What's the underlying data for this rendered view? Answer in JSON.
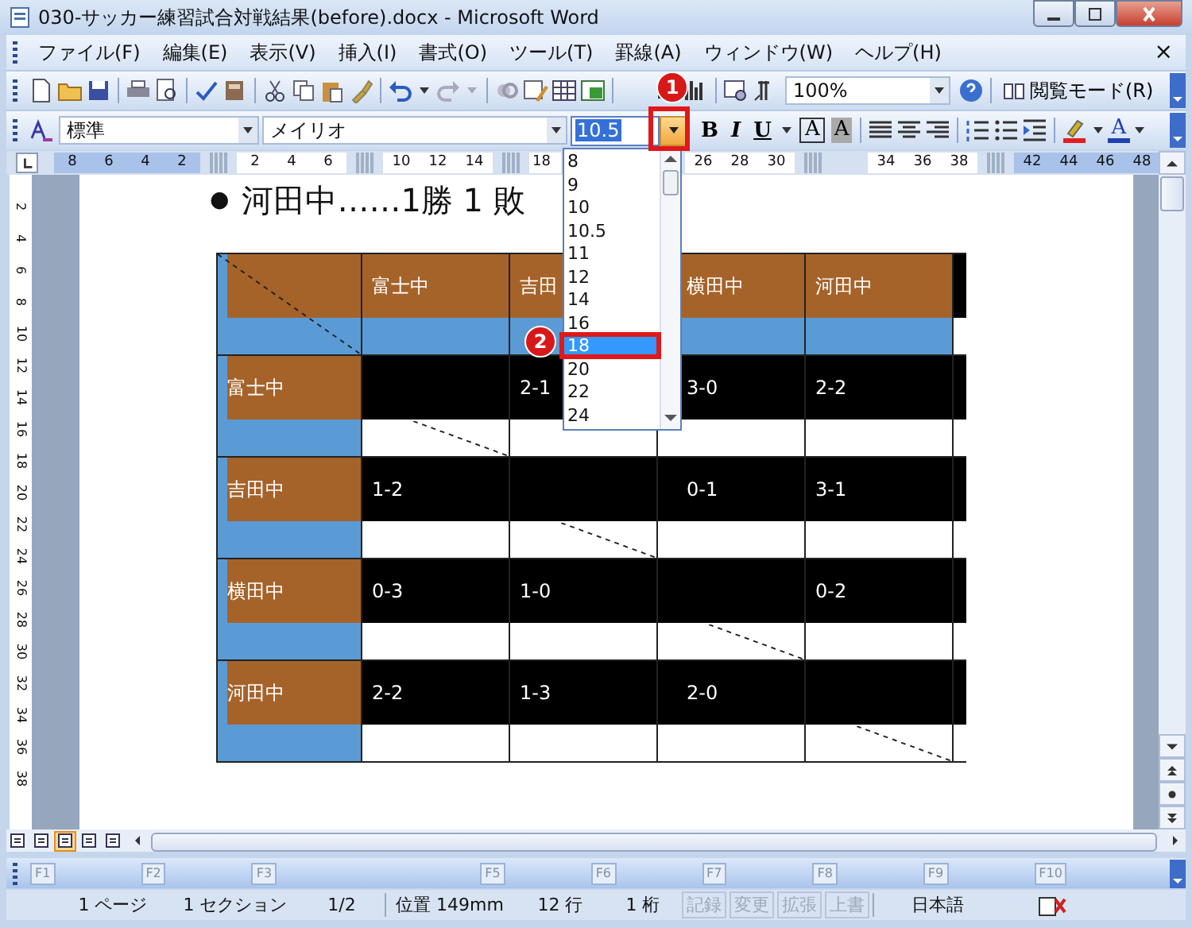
{
  "window": {
    "title": "030-サッカー練習試合対戦結果(before).docx - Microsoft Word"
  },
  "menu": {
    "items": [
      "ファイル(F)",
      "編集(E)",
      "表示(V)",
      "挿入(I)",
      "書式(O)",
      "ツール(T)",
      "罫線(A)",
      "ウィンドウ(W)",
      "ヘルプ(H)"
    ],
    "close": "×"
  },
  "standard_toolbar": {
    "zoom": "100%",
    "reading_mode": "閲覧モード(R)"
  },
  "format_toolbar": {
    "style": "標準",
    "font": "メイリオ",
    "size": "10.5",
    "bold": "B",
    "italic": "I",
    "underline": "U",
    "char_border": "A",
    "char_shading": "A",
    "font_color": "A"
  },
  "ruler": {
    "groups": [
      {
        "kind": "margin",
        "labels": [
          "8",
          "6",
          "4",
          "2"
        ]
      },
      {
        "kind": "text",
        "labels": [
          "2",
          "4",
          "6"
        ]
      },
      {
        "kind": "text",
        "labels": [
          "10",
          "12",
          "14"
        ]
      },
      {
        "kind": "text",
        "labels": [
          "18"
        ]
      },
      {
        "kind": "text",
        "labels": [
          "26",
          "28",
          "30"
        ]
      },
      {
        "kind": "text",
        "labels": [
          "34",
          "36",
          "38"
        ]
      },
      {
        "kind": "margin",
        "labels": [
          "42",
          "44",
          "46",
          "48"
        ]
      }
    ]
  },
  "vertical_ruler": [
    "2",
    "4",
    "6",
    "8",
    "10",
    "12",
    "14",
    "16",
    "18",
    "20",
    "22",
    "24",
    "26",
    "28",
    "30",
    "32",
    "34",
    "36",
    "38"
  ],
  "document": {
    "bullet": "●",
    "heading": "河田中……1勝 1 敗",
    "table": {
      "header": [
        {
          "diagonal": true
        },
        {
          "text": "富士中",
          "diagonal": false
        },
        {
          "text": "吉田",
          "diagonal": false
        },
        {
          "text": "横田中",
          "diagonal": false
        },
        {
          "text": "河田中",
          "diagonal": false
        }
      ],
      "rows": [
        {
          "team": "富士中",
          "cells": [
            {
              "diagonal": true
            },
            {
              "text": "2-1",
              "diagonal": false
            },
            {
              "text": "3-0",
              "diagonal": false
            },
            {
              "text": "2-2",
              "diagonal": false
            }
          ]
        },
        {
          "team": "吉田中",
          "cells": [
            {
              "text": "1-2",
              "diagonal": false
            },
            {
              "diagonal": true
            },
            {
              "text": "0-1",
              "diagonal": false
            },
            {
              "text": "3-1",
              "diagonal": false
            }
          ]
        },
        {
          "team": "横田中",
          "cells": [
            {
              "text": "0-3",
              "diagonal": false
            },
            {
              "text": "1-0",
              "diagonal": false
            },
            {
              "diagonal": true
            },
            {
              "text": "0-2",
              "diagonal": false
            }
          ]
        },
        {
          "team": "河田中",
          "cells": [
            {
              "text": "2-2",
              "diagonal": false
            },
            {
              "text": "1-3",
              "diagonal": false
            },
            {
              "text": "2-0",
              "diagonal": false
            },
            {
              "diagonal": true
            }
          ]
        }
      ]
    }
  },
  "size_list": [
    {
      "label": "8",
      "selected": false
    },
    {
      "label": "9",
      "selected": false
    },
    {
      "label": "10",
      "selected": false
    },
    {
      "label": "10.5",
      "selected": false
    },
    {
      "label": "11",
      "selected": false
    },
    {
      "label": "12",
      "selected": false
    },
    {
      "label": "14",
      "selected": false
    },
    {
      "label": "16",
      "selected": false
    },
    {
      "label": "18",
      "selected": true
    },
    {
      "label": "20",
      "selected": false
    },
    {
      "label": "22",
      "selected": false
    },
    {
      "label": "24",
      "selected": false
    }
  ],
  "callouts": [
    "1",
    "2"
  ],
  "view_buttons": [
    {
      "selected": false
    },
    {
      "selected": false
    },
    {
      "selected": true
    },
    {
      "selected": false
    },
    {
      "selected": false
    }
  ],
  "function_keys": [
    "F1",
    "F2",
    "F3",
    "F5",
    "F6",
    "F7",
    "F8",
    "F9",
    "F10"
  ],
  "status_bar": [
    {
      "label": "1 ページ",
      "disabled": false
    },
    {
      "label": "1 セクション",
      "disabled": false
    },
    {
      "label": "1/2",
      "disabled": false
    },
    {
      "label": "位置 149mm",
      "disabled": false
    },
    {
      "label": "12 行",
      "disabled": false
    },
    {
      "label": "1 桁",
      "disabled": false
    },
    {
      "label": "記録",
      "disabled": true
    },
    {
      "label": "変更",
      "disabled": true
    },
    {
      "label": "拡張",
      "disabled": true
    },
    {
      "label": "上書",
      "disabled": true
    },
    {
      "label": "日本語",
      "disabled": false
    }
  ]
}
